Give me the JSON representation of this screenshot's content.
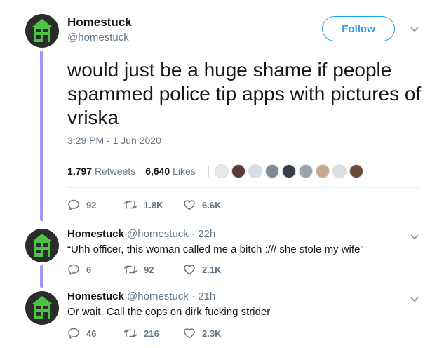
{
  "main_tweet": {
    "author_name": "Homestuck",
    "author_handle": "@homestuck",
    "follow_label": "Follow",
    "text": "would just be a huge shame if people spammed police tip apps with pictures of vriska",
    "timestamp": "3:29 PM - 1 Jun 2020",
    "retweets_count": "1,797",
    "retweets_label": "Retweets",
    "likes_count": "6,640",
    "likes_label": "Likes",
    "actions": {
      "replies": "92",
      "retweets": "1.8K",
      "likes": "6.6K"
    }
  },
  "replies": [
    {
      "author_name": "Homestuck",
      "author_handle": "@homestuck",
      "time": "22h",
      "text": "“Uhh officer, this woman called me a bitch :/// she stole my wife”",
      "actions": {
        "replies": "6",
        "retweets": "92",
        "likes": "2.1K"
      }
    },
    {
      "author_name": "Homestuck",
      "author_handle": "@homestuck",
      "time": "21h",
      "text": "Or wait. Call the cops on dirk fucking strider",
      "actions": {
        "replies": "46",
        "retweets": "216",
        "likes": "2.3K"
      }
    }
  ],
  "colors": {
    "accent": "#1da1f2",
    "thread_line": "#9f98fb",
    "avatar_bg": "#2a2e2a",
    "house_green": "#4fc345"
  }
}
